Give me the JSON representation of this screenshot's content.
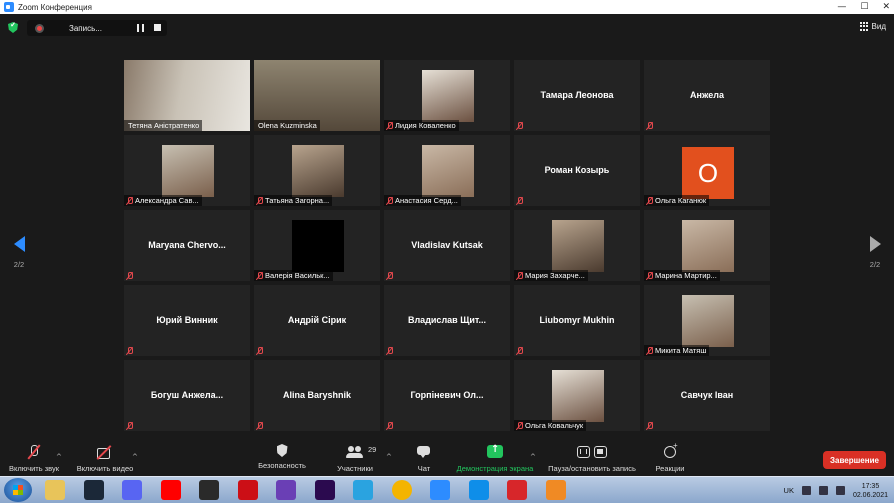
{
  "window": {
    "title": "Zoom Конференция",
    "controls": {
      "minimize": "—",
      "maximize": "☐",
      "close": "✕"
    }
  },
  "topbar": {
    "security_icon": "shield-check-icon",
    "recording": {
      "label": "Запись...",
      "pause_icon": "pause-icon",
      "stop_icon": "stop-icon"
    },
    "view_label": "Вид"
  },
  "gallery": {
    "page_left": "2/2",
    "page_right": "2/2",
    "tiles": [
      {
        "caption": "Тетяна Аністратенко",
        "big": "",
        "muted": false,
        "video": "full",
        "active": false
      },
      {
        "caption": "Olena Kuzminska",
        "big": "",
        "muted": false,
        "video": "full",
        "active": true
      },
      {
        "caption": "Лидия Коваленко",
        "big": "",
        "muted": true,
        "video": "photo",
        "active": false
      },
      {
        "caption": "",
        "big": "Тамара Леонова",
        "muted": true,
        "video": "none",
        "active": false
      },
      {
        "caption": "",
        "big": "Анжела",
        "muted": true,
        "video": "none",
        "active": false
      },
      {
        "caption": "Александра Сав...",
        "big": "",
        "muted": true,
        "video": "photo",
        "active": false
      },
      {
        "caption": "Татьяна Загорна...",
        "big": "",
        "muted": true,
        "video": "photo",
        "active": false
      },
      {
        "caption": "Анастасия Серд...",
        "big": "",
        "muted": true,
        "video": "photo",
        "active": false
      },
      {
        "caption": "",
        "big": "Роман Козырь",
        "muted": true,
        "video": "none",
        "active": false
      },
      {
        "caption": "Ольга Каганюк",
        "big": "",
        "muted": true,
        "video": "avatar",
        "avatar_letter": "O",
        "active": false
      },
      {
        "caption": "",
        "big": "Maryana  Chervo...",
        "muted": true,
        "video": "none",
        "active": false
      },
      {
        "caption": "Валерія Васильк...",
        "big": "",
        "muted": true,
        "video": "black",
        "active": false
      },
      {
        "caption": "",
        "big": "Vladislav Kutsak",
        "muted": true,
        "video": "none",
        "active": false
      },
      {
        "caption": "Мария Захарче...",
        "big": "",
        "muted": true,
        "video": "photo",
        "active": false
      },
      {
        "caption": "Марина Мартир...",
        "big": "",
        "muted": true,
        "video": "photo",
        "active": false
      },
      {
        "caption": "",
        "big": "Юрий Винник",
        "muted": true,
        "video": "none",
        "active": false
      },
      {
        "caption": "",
        "big": "Андрій Сірик",
        "muted": true,
        "video": "none",
        "active": false
      },
      {
        "caption": "",
        "big": "Владислав  Щит...",
        "muted": true,
        "video": "none",
        "active": false
      },
      {
        "caption": "",
        "big": "Liubomyr Mukhin",
        "muted": true,
        "video": "none",
        "active": false
      },
      {
        "caption": "Микита Матяш",
        "big": "",
        "muted": true,
        "video": "photo",
        "active": false
      },
      {
        "caption": "",
        "big": "Богуш  Анжела...",
        "muted": true,
        "video": "none",
        "active": false
      },
      {
        "caption": "",
        "big": "Alina Baryshnik",
        "muted": true,
        "video": "none",
        "active": false
      },
      {
        "caption": "",
        "big": "Горпіневич  Ол...",
        "muted": true,
        "video": "none",
        "active": false
      },
      {
        "caption": "Ольга Ковальчук",
        "big": "",
        "muted": true,
        "video": "photo",
        "active": false
      },
      {
        "caption": "",
        "big": "Савчук Іван",
        "muted": true,
        "video": "none",
        "active": false
      }
    ]
  },
  "toolbar": {
    "audio_label": "Включить звук",
    "video_label": "Включить видео",
    "security_label": "Безопасность",
    "participants_label": "Участники",
    "participants_count": "29",
    "chat_label": "Чат",
    "share_label": "Демонстрация экрана",
    "record_label": "Пауза/остановить запись",
    "reactions_label": "Реакции",
    "end_label": "Завершение",
    "caret": "^"
  },
  "taskbar": {
    "apps": [
      "explorer-icon",
      "steam-icon",
      "discord-icon",
      "youtube-music-icon",
      "video-editor-icon",
      "opera-icon",
      "pen-app-icon",
      "premiere-icon",
      "telegram-icon",
      "chrome-icon",
      "zoom-icon",
      "teamviewer-icon",
      "ccleaner-icon",
      "media-player-icon"
    ],
    "lang": "UK",
    "time": "17:35",
    "date": "02.06.2021"
  },
  "colors": {
    "accent": "#2d8cff",
    "active_speaker": "#d6e34a",
    "end": "#d93025",
    "share": "#22c55e",
    "muted": "#e5484d"
  }
}
